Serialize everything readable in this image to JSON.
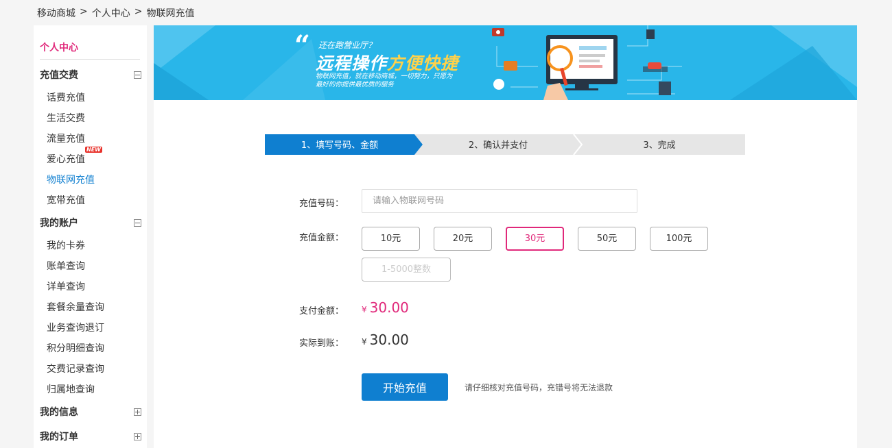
{
  "breadcrumb": {
    "home": "移动商城",
    "level2": "个人中心",
    "current": "物联网充值",
    "sep": ">"
  },
  "sidebar": {
    "title": "个人中心",
    "groups": {
      "recharge": {
        "label": "充值交费",
        "items": [
          "话费充值",
          "生活交费",
          "流量充值",
          "爱心充值",
          "物联网充值",
          "宽带充值"
        ],
        "new_badge": "NEW"
      },
      "account": {
        "label": "我的账户",
        "items": [
          "我的卡券",
          "账单查询",
          "详单查询",
          "套餐余量查询",
          "业务查询退订",
          "积分明细查询",
          "交费记录查询",
          "归属地查询"
        ]
      },
      "info": {
        "label": "我的信息"
      },
      "orders": {
        "label": "我的订单"
      }
    }
  },
  "banner": {
    "quote": "“",
    "subtitle": "还在跑营业厅？",
    "headline_a": "远程操作",
    "headline_b": "方便快捷",
    "desc": "物联网充值，就在移动商城，一切努力，只愿为最好的你提供最优质的服务"
  },
  "steps": [
    "1、填写号码、金额",
    "2、确认并支付",
    "3、完成"
  ],
  "form": {
    "phone_label": "充值号码：",
    "phone_placeholder": "请输入物联网号码",
    "amount_label": "充值金额：",
    "amounts": [
      "10元",
      "20元",
      "30元",
      "50元",
      "100元"
    ],
    "selected_amount": "30元",
    "custom_placeholder": "1-5000整数",
    "pay_label": "支付金额：",
    "pay_currency": "¥",
    "pay_value": "30.00",
    "real_label": "实际到账：",
    "real_currency": "¥",
    "real_value": "30.00",
    "submit_label": "开始充值",
    "note": "请仔细核对充值号码，充错号将无法退款"
  },
  "colors": {
    "accent_pink": "#e0287a",
    "accent_blue": "#0f7fd0",
    "banner_bg": "#29b6e9"
  }
}
